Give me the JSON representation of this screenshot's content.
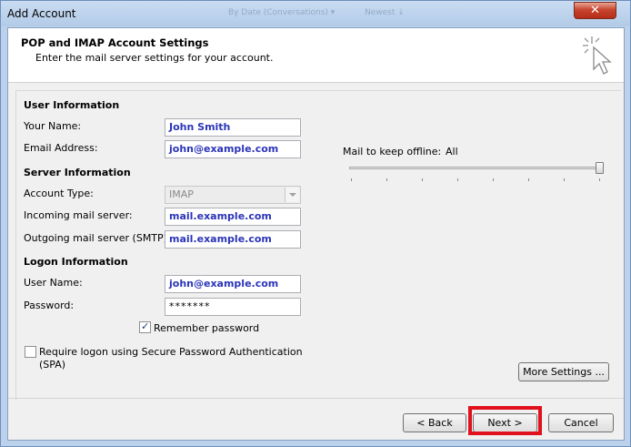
{
  "window": {
    "title": "Add Account",
    "bg_ghost_1": "By Date (Conversations) ▾",
    "bg_ghost_2": "Newest ↓"
  },
  "header": {
    "title": "POP and IMAP Account Settings",
    "subtitle": "Enter the mail server settings for your account."
  },
  "user_info": {
    "heading": "User Information",
    "name_label": "Your Name:",
    "name_value": "John Smith",
    "email_label": "Email Address:",
    "email_value": "john@example.com"
  },
  "server_info": {
    "heading": "Server Information",
    "account_type_label": "Account Type:",
    "account_type_value": "IMAP",
    "incoming_label": "Incoming mail server:",
    "incoming_value": "mail.example.com",
    "outgoing_label": "Outgoing mail server (SMTP):",
    "outgoing_value": "mail.example.com"
  },
  "logon_info": {
    "heading": "Logon Information",
    "user_label": "User Name:",
    "user_value": "john@example.com",
    "password_label": "Password:",
    "password_value": "*******",
    "remember_label": "Remember password",
    "remember_checked": true,
    "spa_label": "Require logon using Secure Password Authentication (SPA)",
    "spa_checked": false
  },
  "offline": {
    "label": "Mail to keep offline:",
    "value": "All",
    "slider_level": 1.0
  },
  "buttons": {
    "more_settings": "More Settings ...",
    "back": "< Back",
    "next": "Next >",
    "cancel": "Cancel",
    "close": "✕"
  },
  "colors": {
    "field_text": "#2b35b8",
    "highlight": "#e0111c",
    "close_button": "#c7452f"
  }
}
